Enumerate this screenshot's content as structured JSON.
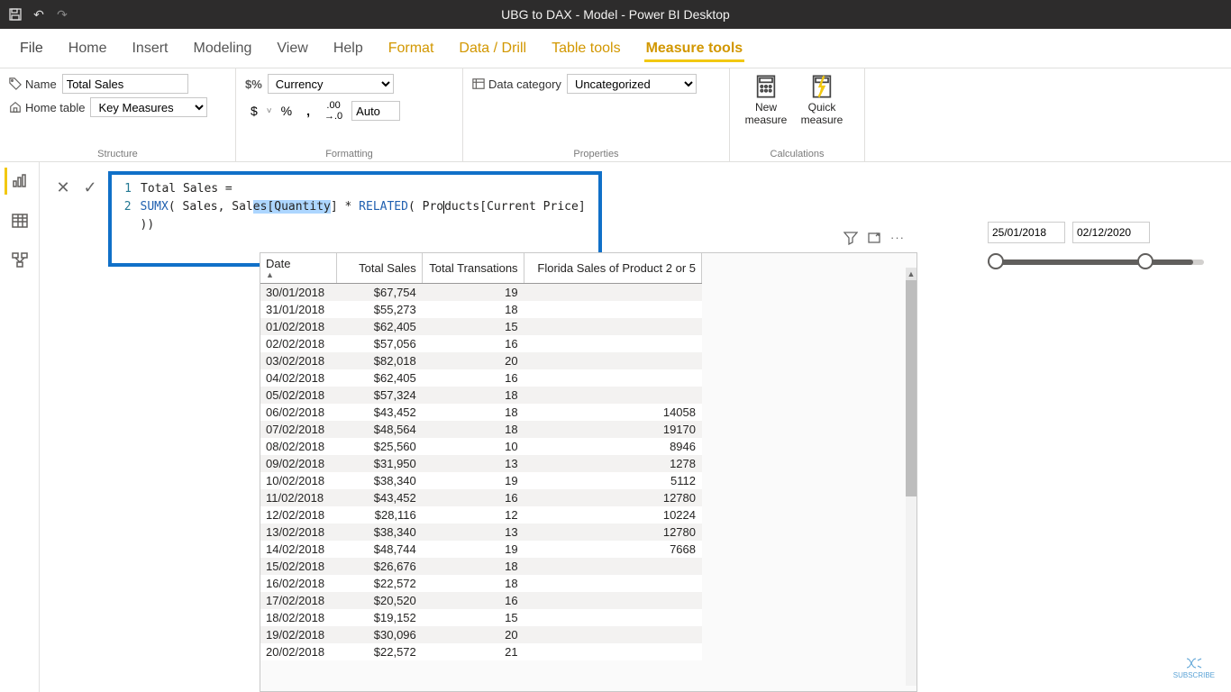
{
  "app": {
    "title": "UBG to DAX - Model - Power BI Desktop"
  },
  "menu": {
    "file": "File",
    "home": "Home",
    "insert": "Insert",
    "modeling": "Modeling",
    "view": "View",
    "help": "Help",
    "format": "Format",
    "datadrill": "Data / Drill",
    "tabletools": "Table tools",
    "measuretools": "Measure tools"
  },
  "structure": {
    "label": "Structure",
    "name_lbl": "Name",
    "name_val": "Total Sales",
    "home_lbl": "Home table",
    "home_val": "Key Measures"
  },
  "formatting": {
    "label": "Formatting",
    "format_val": "Currency",
    "decimals_val": "Auto",
    "dollar": "$",
    "percent": "%",
    "comma": ",",
    "dec": ".00"
  },
  "properties": {
    "label": "Properties",
    "cat_lbl": "Data category",
    "cat_val": "Uncategorized"
  },
  "calculations": {
    "label": "Calculations",
    "new_measure": "New measure",
    "quick_measure": "Quick measure"
  },
  "formula": {
    "line1_a": "Total Sales =",
    "sumx": "SUMX",
    "l2_a": "( Sales, Sal",
    "sel": "es[Quantity",
    "l2_b": "] * ",
    "related": "RELATED",
    "l2_c": "( Pro",
    "l2_c2": "ducts[Current Price] ))"
  },
  "slicer": {
    "from": "25/01/2018",
    "to": "02/12/2020"
  },
  "table": {
    "cols": {
      "date": "Date",
      "totalsales": "Total Sales",
      "trans": "Total Transations",
      "fl": "Florida Sales of Product 2 or 5"
    },
    "rows": [
      {
        "d": "30/01/2018",
        "ts": "$67,754",
        "tt": "19",
        "fl": ""
      },
      {
        "d": "31/01/2018",
        "ts": "$55,273",
        "tt": "18",
        "fl": ""
      },
      {
        "d": "01/02/2018",
        "ts": "$62,405",
        "tt": "15",
        "fl": ""
      },
      {
        "d": "02/02/2018",
        "ts": "$57,056",
        "tt": "16",
        "fl": ""
      },
      {
        "d": "03/02/2018",
        "ts": "$82,018",
        "tt": "20",
        "fl": ""
      },
      {
        "d": "04/02/2018",
        "ts": "$62,405",
        "tt": "16",
        "fl": ""
      },
      {
        "d": "05/02/2018",
        "ts": "$57,324",
        "tt": "18",
        "fl": ""
      },
      {
        "d": "06/02/2018",
        "ts": "$43,452",
        "tt": "18",
        "fl": "14058"
      },
      {
        "d": "07/02/2018",
        "ts": "$48,564",
        "tt": "18",
        "fl": "19170"
      },
      {
        "d": "08/02/2018",
        "ts": "$25,560",
        "tt": "10",
        "fl": "8946"
      },
      {
        "d": "09/02/2018",
        "ts": "$31,950",
        "tt": "13",
        "fl": "1278"
      },
      {
        "d": "10/02/2018",
        "ts": "$38,340",
        "tt": "19",
        "fl": "5112"
      },
      {
        "d": "11/02/2018",
        "ts": "$43,452",
        "tt": "16",
        "fl": "12780"
      },
      {
        "d": "12/02/2018",
        "ts": "$28,116",
        "tt": "12",
        "fl": "10224"
      },
      {
        "d": "13/02/2018",
        "ts": "$38,340",
        "tt": "13",
        "fl": "12780"
      },
      {
        "d": "14/02/2018",
        "ts": "$48,744",
        "tt": "19",
        "fl": "7668"
      },
      {
        "d": "15/02/2018",
        "ts": "$26,676",
        "tt": "18",
        "fl": ""
      },
      {
        "d": "16/02/2018",
        "ts": "$22,572",
        "tt": "18",
        "fl": ""
      },
      {
        "d": "17/02/2018",
        "ts": "$20,520",
        "tt": "16",
        "fl": ""
      },
      {
        "d": "18/02/2018",
        "ts": "$19,152",
        "tt": "15",
        "fl": ""
      },
      {
        "d": "19/02/2018",
        "ts": "$30,096",
        "tt": "20",
        "fl": ""
      },
      {
        "d": "20/02/2018",
        "ts": "$22,572",
        "tt": "21",
        "fl": ""
      }
    ]
  },
  "subscribe": "SUBSCRIBE"
}
